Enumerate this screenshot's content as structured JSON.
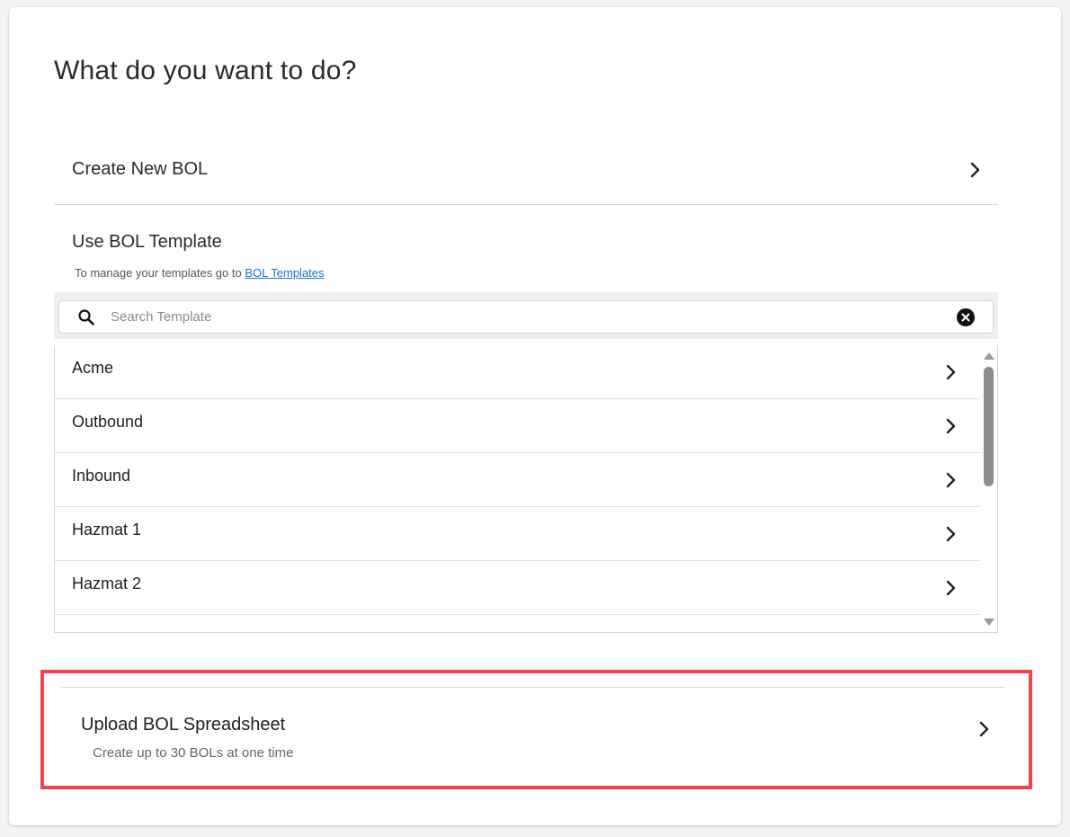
{
  "page": {
    "title": "What do you want to do?"
  },
  "create_option": {
    "label": "Create New BOL",
    "icon": "chevron-right-icon"
  },
  "template_section": {
    "title": "Use BOL Template",
    "hint_prefix": "To manage your templates go to",
    "hint_link": "BOL Templates",
    "search": {
      "placeholder": "Search Template",
      "value": "",
      "icon": "search-icon",
      "clear_icon": "clear-icon"
    },
    "items": [
      {
        "label": "Acme"
      },
      {
        "label": "Outbound"
      },
      {
        "label": "Inbound"
      },
      {
        "label": "Hazmat 1"
      },
      {
        "label": "Hazmat 2"
      }
    ]
  },
  "upload_option": {
    "label": "Upload BOL Spreadsheet",
    "sublabel": "Create up to 30 BOLs at one time",
    "icon": "chevron-right-icon"
  },
  "colors": {
    "highlight": "#f2444c",
    "link": "#1a73c9"
  }
}
